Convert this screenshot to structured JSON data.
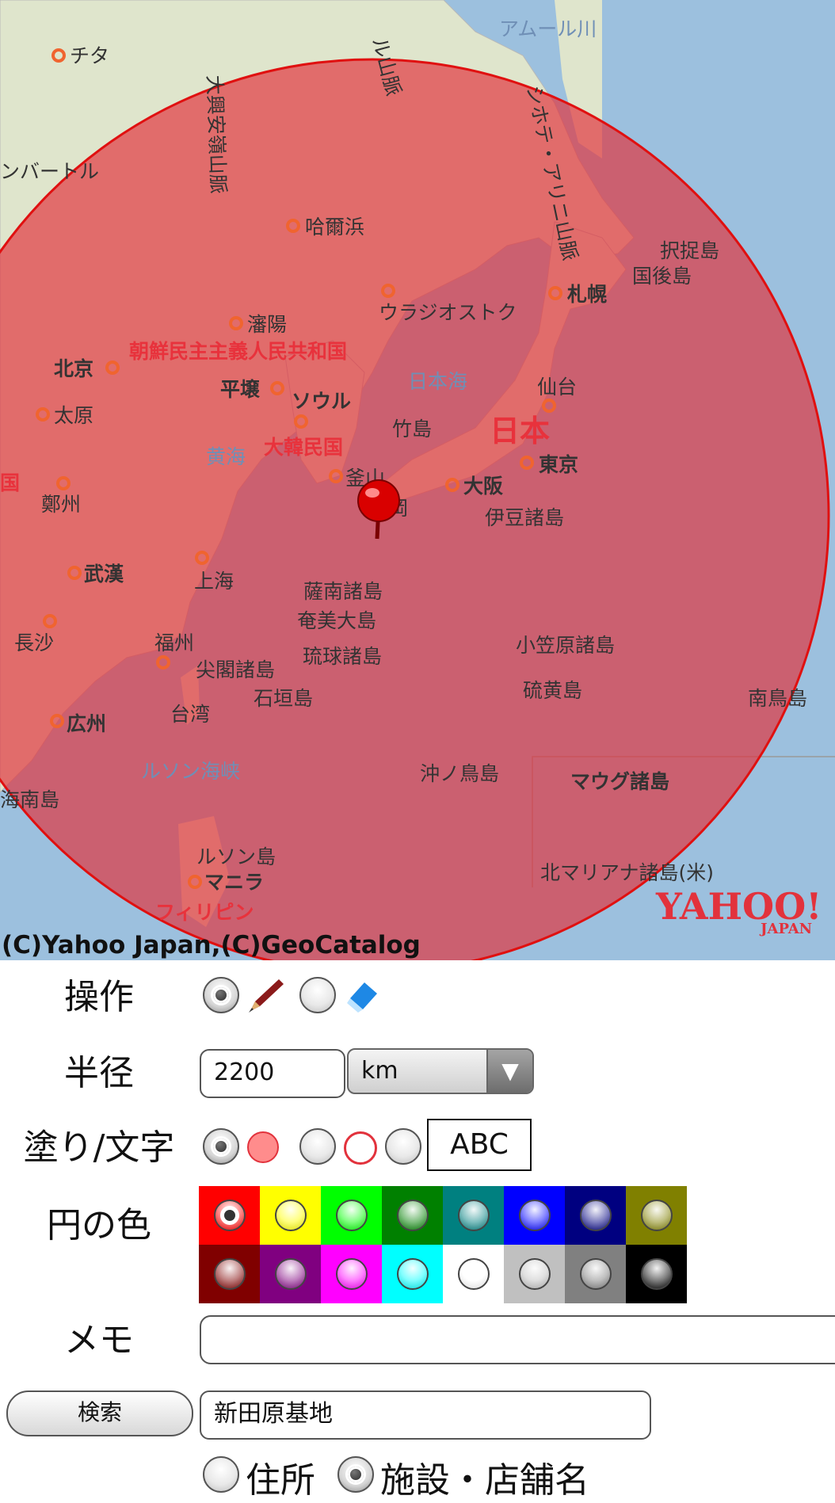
{
  "map": {
    "copyright": "(C)Yahoo Japan,(C)GeoCatalog",
    "logo_main": "YAHOO!",
    "logo_sub": "JAPAN",
    "labels": {
      "chita": "チタ",
      "amur": "アムール川",
      "alu": "ル山脈",
      "daxinganling": "大興安嶺山脈",
      "sikhote": "シホテ・アリニ山脈",
      "baatar": "ンバートル",
      "harbin": "哈爾浜",
      "etorofu": "択捉島",
      "kunashiri": "国後島",
      "sapporo": "札幌",
      "vladivostok": "ウラジオストク",
      "shenyang": "瀋陽",
      "dprk": "朝鮮民主主義人民共和国",
      "beijing": "北京",
      "pyongyang": "平壌",
      "seoul": "ソウル",
      "japan_sea": "日本海",
      "sendai": "仙台",
      "taiyuan": "太原",
      "takeshima": "竹島",
      "japan": "日本",
      "tokyo": "東京",
      "yellow_sea": "黄海",
      "rok": "大韓民国",
      "busan": "釜山",
      "osaka": "大阪",
      "china_edge": "国",
      "zhengzhou": "鄭州",
      "fukuoka": "岡",
      "izu": "伊豆諸島",
      "wuhan": "武漢",
      "shanghai": "上海",
      "satsunan": "薩南諸島",
      "amami": "奄美大島",
      "changsha": "長沙",
      "fuzhou": "福州",
      "ogasawara": "小笠原諸島",
      "ryukyu": "琉球諸島",
      "senkaku": "尖閣諸島",
      "iwoto": "硫黄島",
      "ishigaki": "石垣島",
      "minamitori": "南鳥島",
      "guangzhou": "広州",
      "taiwan": "台湾",
      "luzon_strait": "ルソン海峡",
      "okinotori": "沖ノ鳥島",
      "maug": "マウグ諸島",
      "hainan": "海南島",
      "luzon": "ルソン島",
      "manila": "マニラ",
      "n_mariana": "北マリアナ諸島(米)",
      "philippines": "フィリピン"
    }
  },
  "form": {
    "operation_label": "操作",
    "radius_label": "半径",
    "radius_value": "2200",
    "unit_value": "km",
    "fill_label": "塗り/文字",
    "abc_text": "ABC",
    "color_label": "円の色",
    "memo_label": "メモ",
    "memo_value": "",
    "search_button": "検索",
    "search_value": "新田原基地",
    "search_type_address": "住所",
    "search_type_facility": "施設・店舗名"
  },
  "colors": {
    "circle_fill": "#e2323c",
    "row1": [
      "#ff0000",
      "#ffff00",
      "#00ff00",
      "#008000",
      "#008080",
      "#0000ff",
      "#000080",
      "#808000"
    ],
    "row2": [
      "#800000",
      "#800080",
      "#ff00ff",
      "#00ffff",
      "#ffffff",
      "#c0c0c0",
      "#808080",
      "#000000"
    ]
  }
}
